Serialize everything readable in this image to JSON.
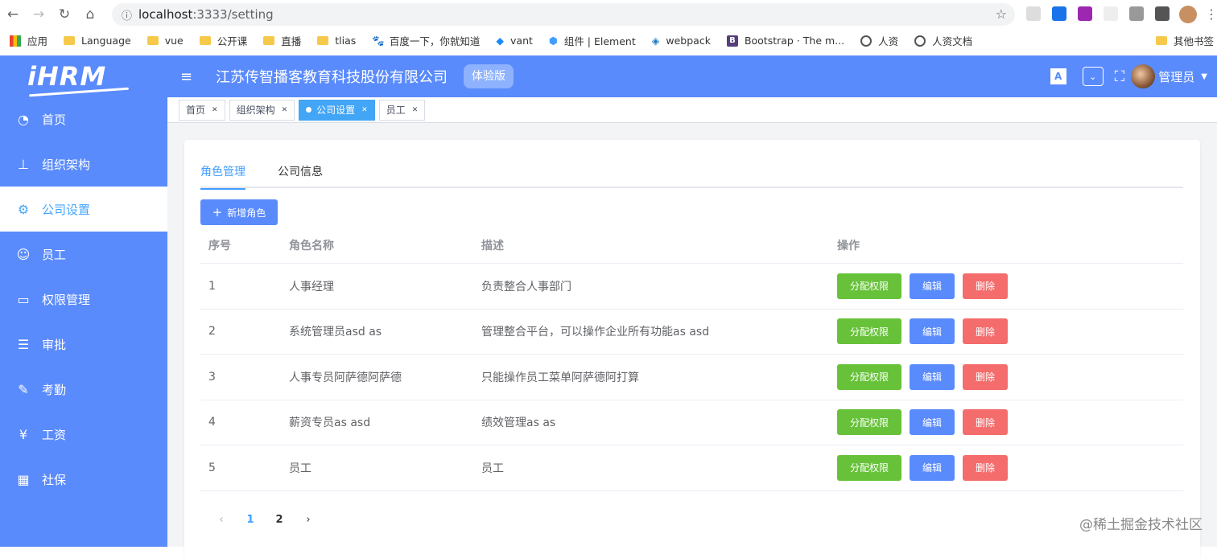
{
  "browser": {
    "url_host": "localhost",
    "url_path": ":3333/setting",
    "bookmarks": [
      {
        "label": "应用",
        "icon": "apps-grid-icon"
      },
      {
        "label": "Language",
        "icon": "folder-icon"
      },
      {
        "label": "vue",
        "icon": "folder-icon"
      },
      {
        "label": "公开课",
        "icon": "folder-icon"
      },
      {
        "label": "直播",
        "icon": "folder-icon"
      },
      {
        "label": "tlias",
        "icon": "folder-icon"
      },
      {
        "label": "百度一下，你就知道",
        "icon": "baidu-icon"
      },
      {
        "label": "vant",
        "icon": "vant-icon"
      },
      {
        "label": "组件 | Element",
        "icon": "element-icon"
      },
      {
        "label": "webpack",
        "icon": "webpack-icon"
      },
      {
        "label": "Bootstrap · The m...",
        "icon": "bootstrap-icon"
      },
      {
        "label": "人资",
        "icon": "globe-icon"
      },
      {
        "label": "人资文档",
        "icon": "globe-icon"
      }
    ],
    "other_bookmarks": "其他书签"
  },
  "sidebar": {
    "logo": "iHRM",
    "items": [
      {
        "label": "首页",
        "icon": "dashboard-icon"
      },
      {
        "label": "组织架构",
        "icon": "tree-icon"
      },
      {
        "label": "公司设置",
        "icon": "gear-icon"
      },
      {
        "label": "员工",
        "icon": "people-icon"
      },
      {
        "label": "权限管理",
        "icon": "lock-icon"
      },
      {
        "label": "审批",
        "icon": "tree-table-icon"
      },
      {
        "label": "考勤",
        "icon": "skill-icon"
      },
      {
        "label": "工资",
        "icon": "money-icon"
      },
      {
        "label": "社保",
        "icon": "table-icon"
      }
    ],
    "active_index": 2
  },
  "header": {
    "company": "江苏传智播客教育科技股份有限公司",
    "badge": "体验版",
    "username": "管理员",
    "lang_icon": "A"
  },
  "tags": [
    {
      "label": "首页"
    },
    {
      "label": "组织架构"
    },
    {
      "label": "公司设置"
    },
    {
      "label": "员工"
    }
  ],
  "tabs": [
    "角色管理",
    "公司信息"
  ],
  "add_button": "新增角色",
  "table": {
    "headers": [
      "序号",
      "角色名称",
      "描述",
      "操作"
    ],
    "rows": [
      {
        "id": "1",
        "name": "人事经理",
        "desc": "负责整合人事部门"
      },
      {
        "id": "2",
        "name": "系统管理员asd as",
        "desc": "管理整合平台，可以操作企业所有功能as asd"
      },
      {
        "id": "3",
        "name": "人事专员阿萨德阿萨德",
        "desc": "只能操作员工菜单阿萨德阿打算"
      },
      {
        "id": "4",
        "name": "薪资专员as asd",
        "desc": "绩效管理as as"
      },
      {
        "id": "5",
        "name": "员工",
        "desc": "员工"
      }
    ],
    "actions": {
      "assign": "分配权限",
      "edit": "编辑",
      "delete": "删除"
    }
  },
  "pagination": {
    "pages": [
      "1",
      "2"
    ],
    "current": "1"
  },
  "watermark": "@稀土掘金技术社区"
}
